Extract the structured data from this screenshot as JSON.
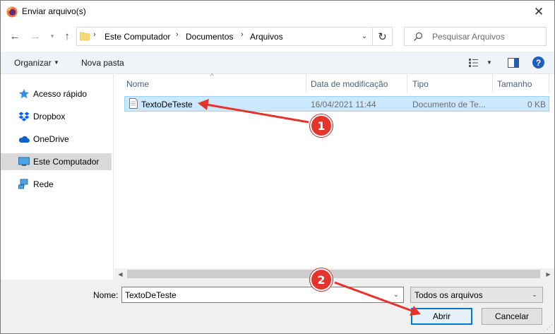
{
  "window": {
    "title": "Enviar arquivo(s)"
  },
  "address": {
    "crumbs": [
      "Este Computador",
      "Documentos",
      "Arquivos"
    ],
    "search_placeholder": "Pesquisar Arquivos"
  },
  "toolbar": {
    "organize_label": "Organizar",
    "new_folder_label": "Nova pasta"
  },
  "sidebar": {
    "items": [
      {
        "label": "Acesso rápido",
        "icon": "star-icon",
        "selected": false
      },
      {
        "label": "Dropbox",
        "icon": "dropbox-icon",
        "selected": false
      },
      {
        "label": "OneDrive",
        "icon": "cloud-icon",
        "selected": false
      },
      {
        "label": "Este Computador",
        "icon": "computer-icon",
        "selected": true
      },
      {
        "label": "Rede",
        "icon": "network-icon",
        "selected": false
      }
    ]
  },
  "filelist": {
    "columns": [
      "Nome",
      "Data de modificação",
      "Tipo",
      "Tamanho"
    ],
    "rows": [
      {
        "name": "TextoDeTeste",
        "modified": "16/04/2021 11:44",
        "type": "Documento de Te...",
        "size": "0 KB",
        "selected": true
      }
    ]
  },
  "bottom": {
    "name_label": "Nome:",
    "name_value": "TextoDeTeste",
    "file_type": "Todos os arquivos",
    "open_label": "Abrir",
    "cancel_label": "Cancelar"
  },
  "annotations": {
    "badge1": "1",
    "badge2": "2",
    "color": "#e5342b"
  },
  "colors": {
    "selection": "#cce8ff",
    "accent": "#0078d7",
    "toolbar_bg": "#f0f4f9"
  }
}
